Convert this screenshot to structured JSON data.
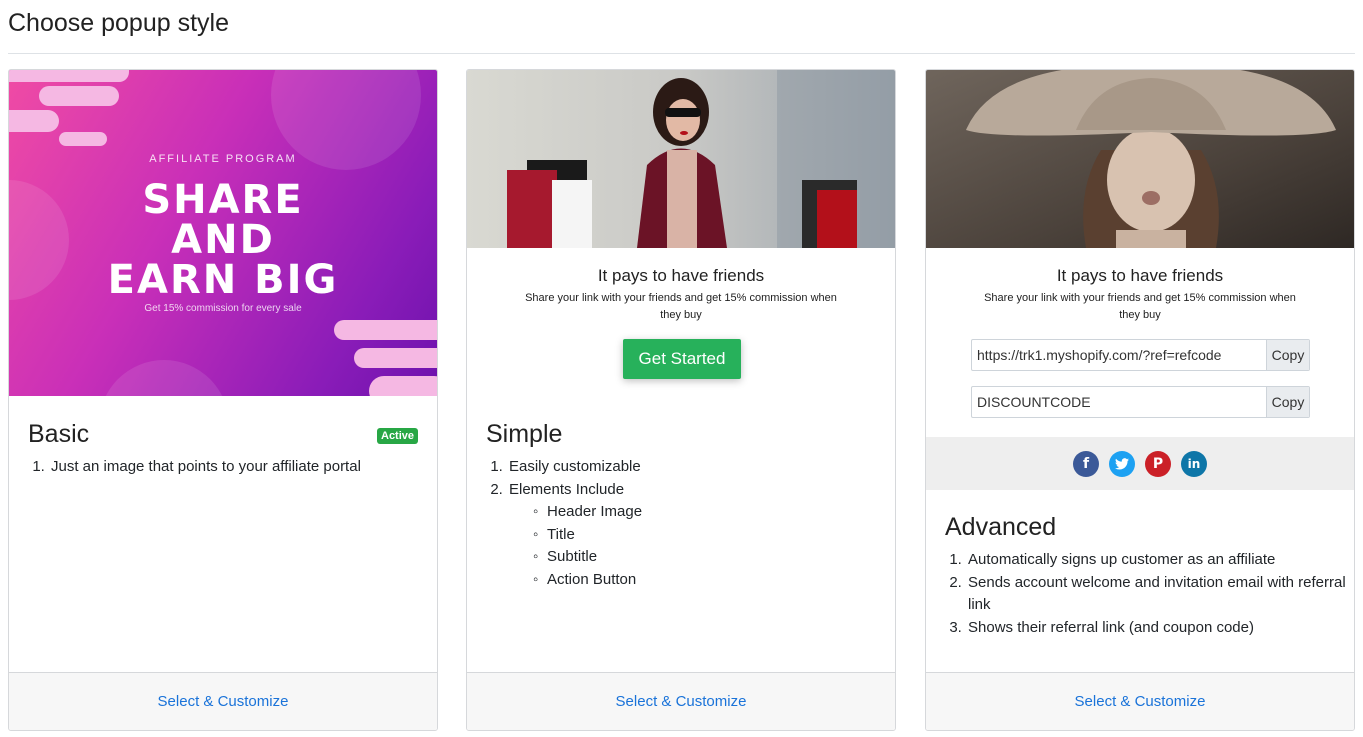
{
  "page": {
    "title": "Choose popup style"
  },
  "cards": [
    {
      "title": "Basic",
      "badge": "Active",
      "preview": {
        "label": "AFFILIATE PROGRAM",
        "headline_1": "SHARE",
        "headline_2": "AND",
        "headline_3": "EARN BIG",
        "subtext": "Get 15% commission for every sale"
      },
      "features": [
        "Just an image that points to your affiliate portal"
      ],
      "action": "Select & Customize"
    },
    {
      "title": "Simple",
      "preview": {
        "heading": "It pays to have friends",
        "subtext": "Share your link with your friends and get 15% commission when they buy",
        "button": "Get Started"
      },
      "features": [
        "Easily customizable",
        "Elements Include"
      ],
      "sub_features": [
        "Header Image",
        "Title",
        "Subtitle",
        "Action Button"
      ],
      "action": "Select & Customize"
    },
    {
      "title": "Advanced",
      "preview": {
        "heading": "It pays to have friends",
        "subtext": "Share your link with your friends and get 15% commission when they buy",
        "link_value": "https://trk1.myshopify.com/?ref=refcode",
        "code_value": "DISCOUNTCODE",
        "copy_label": "Copy",
        "social_icons": [
          "facebook-icon",
          "twitter-icon",
          "pinterest-icon",
          "linkedin-icon"
        ]
      },
      "features": [
        "Automatically signs up customer as an affiliate",
        "Sends account welcome and invitation email with referral link",
        "Shows their referral link (and coupon code)"
      ],
      "action": "Select & Customize"
    }
  ],
  "colors": {
    "link": "#1a73d9",
    "active_badge": "#28a745",
    "get_started": "#27b15b",
    "facebook": "#3b5998",
    "twitter": "#1da1f2",
    "pinterest": "#cb2027",
    "linkedin": "#0e76a8"
  }
}
